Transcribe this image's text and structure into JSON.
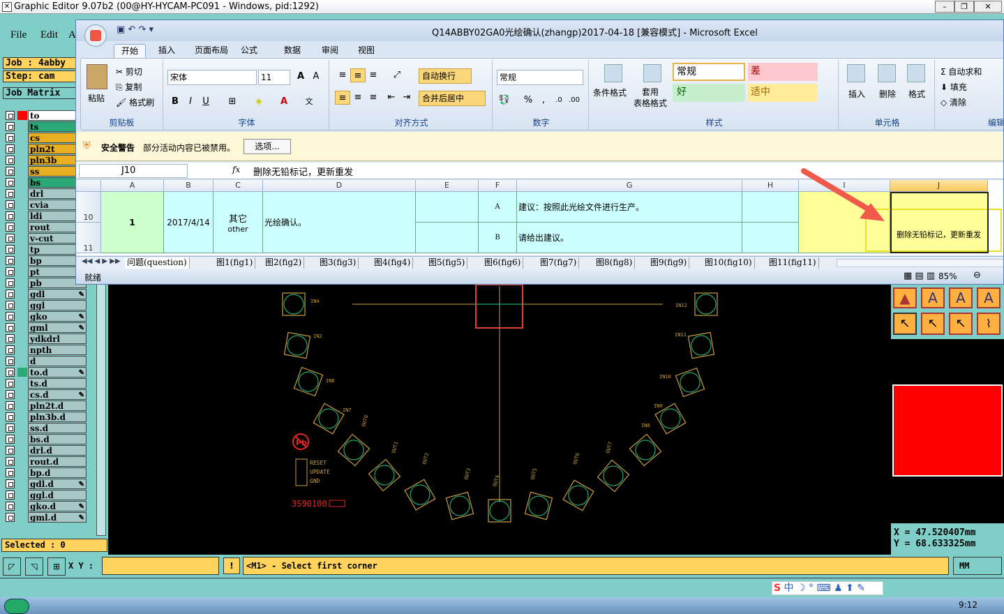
{
  "ge": {
    "title": "Graphic Editor 9.07b2 (00@HY-HYCAM-PC091 - Windows, pid:1292)",
    "menu": [
      "File",
      "Edit",
      "A"
    ],
    "job_label": "Job  : 4abby",
    "step_label": "Step: cam",
    "matrix_label": "Job Matrix",
    "layers": [
      {
        "name": "to",
        "color": "#ffffff",
        "sw": "#ff0000",
        "pen": false
      },
      {
        "name": "ts",
        "color": "#2aa876",
        "pen": false
      },
      {
        "name": "cs",
        "color": "#e8b020",
        "pen": false
      },
      {
        "name": "pln2t",
        "color": "#e8b020",
        "pen": false
      },
      {
        "name": "pln3b",
        "color": "#e8b020",
        "pen": false
      },
      {
        "name": "ss",
        "color": "#e8b020",
        "pen": false
      },
      {
        "name": "bs",
        "color": "#2aa876",
        "pen": false
      },
      {
        "name": "drl",
        "color": "#a8c8c8",
        "pen": false
      },
      {
        "name": "cvia",
        "color": "#a8c8c8",
        "pen": false
      },
      {
        "name": "ldi",
        "color": "#a8c8c8",
        "pen": false
      },
      {
        "name": "rout",
        "color": "#a8c8c8",
        "pen": false
      },
      {
        "name": "v-cut",
        "color": "#a8c8c8",
        "pen": false
      },
      {
        "name": "tp",
        "color": "#a8c8c8",
        "pen": false
      },
      {
        "name": "bp",
        "color": "#a8c8c8",
        "pen": false
      },
      {
        "name": "pt",
        "color": "#a8c8c8",
        "pen": false
      },
      {
        "name": "pb",
        "color": "#a8c8c8",
        "pen": false
      },
      {
        "name": "gdl",
        "color": "#a8c8c8",
        "pen": true
      },
      {
        "name": "ggl",
        "color": "#a8c8c8",
        "pen": false
      },
      {
        "name": "gko",
        "color": "#a8c8c8",
        "pen": true
      },
      {
        "name": "gml",
        "color": "#a8c8c8",
        "pen": true
      },
      {
        "name": "ydkdrl",
        "color": "#a8c8c8",
        "pen": false
      },
      {
        "name": "npth",
        "color": "#a8c8c8",
        "pen": false
      },
      {
        "name": "d",
        "color": "#a8c8c8",
        "pen": false
      },
      {
        "name": "to.d",
        "color": "#a8c8c8",
        "sw": "#2aa876",
        "pen": true
      },
      {
        "name": "ts.d",
        "color": "#a8c8c8",
        "pen": false
      },
      {
        "name": "cs.d",
        "color": "#a8c8c8",
        "pen": true
      },
      {
        "name": "pln2t.d",
        "color": "#a8c8c8",
        "pen": false
      },
      {
        "name": "pln3b.d",
        "color": "#a8c8c8",
        "pen": false
      },
      {
        "name": "ss.d",
        "color": "#a8c8c8",
        "pen": false
      },
      {
        "name": "bs.d",
        "color": "#a8c8c8",
        "pen": false
      },
      {
        "name": "drl.d",
        "color": "#a8c8c8",
        "pen": false
      },
      {
        "name": "rout.d",
        "color": "#a8c8c8",
        "pen": false
      },
      {
        "name": "bp.d",
        "color": "#a8c8c8",
        "pen": false
      },
      {
        "name": "gdl.d",
        "color": "#a8c8c8",
        "pen": true
      },
      {
        "name": "ggl.d",
        "color": "#a8c8c8",
        "pen": false
      },
      {
        "name": "gko.d",
        "color": "#a8c8c8",
        "pen": true
      },
      {
        "name": "gml.d",
        "color": "#a8c8c8",
        "pen": true
      }
    ],
    "selected": "Selected : 0",
    "coord_x": "X  =  47.520407mm",
    "coord_y": "Y  =  68.633325mm",
    "xy_label": "X Y :",
    "prompt": "<M1> - Select first corner",
    "units": "MM",
    "clock": "9:12",
    "pcb_labels": [
      "IN4",
      "IN2",
      "IN6",
      "IN7",
      "OUT0",
      "OUT1",
      "OUT2",
      "OUT3",
      "OUT4",
      "OUT5",
      "OUT6",
      "OUT7",
      "IN8",
      "IN10",
      "IN11",
      "IN12"
    ],
    "pcb_text": [
      "RESET",
      "UPDATE",
      "GND"
    ],
    "pcb_code": "3S90100"
  },
  "xl": {
    "title": "Q14ABBY02GA0光绘确认(zhangp)2017-04-18  [兼容模式] - Microsoft Excel",
    "tabs": [
      "开始",
      "插入",
      "页面布局",
      "公式",
      "数据",
      "审阅",
      "视图"
    ],
    "clipboard": {
      "paste": "粘贴",
      "cut": "剪切",
      "copy": "复制",
      "painter": "格式刷",
      "label": "剪贴板"
    },
    "font": {
      "name": "宋体",
      "size": "11",
      "label": "字体"
    },
    "align": {
      "wrap": "自动换行",
      "merge": "合并后居中",
      "label": "对齐方式"
    },
    "number": {
      "format": "常规",
      "label": "数字"
    },
    "styles": {
      "cond": "条件格式",
      "table": "套用\n表格格式",
      "normal": "常规",
      "bad": "差",
      "good": "好",
      "neutral": "适中",
      "label": "样式"
    },
    "cells": {
      "insert": "插入",
      "delete": "删除",
      "format": "格式",
      "label": "单元格"
    },
    "edit": {
      "autosum": "自动求和",
      "fill": "填充",
      "clear": "清除",
      "label": "编辑"
    },
    "security": {
      "warn": "安全警告",
      "msg": "部分活动内容已被禁用。",
      "opt": "选项..."
    },
    "namebox": "J10",
    "formula": "删除无铅标记，更新重发",
    "cols": [
      "A",
      "B",
      "C",
      "D",
      "E",
      "F",
      "G",
      "H",
      "I",
      "J"
    ],
    "rows": [
      "10",
      "11"
    ],
    "cells_data": {
      "A": "1",
      "B": "2017/4/14",
      "C1": "其它",
      "C2": "other",
      "D": "光绘确认。",
      "F1": "A",
      "F2": "B",
      "G1": "建议：按照此光绘文件进行生产。",
      "G2": "请给出建议。",
      "J": "删除无铅标记，更新重发"
    },
    "sheets": [
      "问题(question)",
      "图1(fig1)",
      "图2(fig2)",
      "图3(fig3)",
      "图4(fig4)",
      "图5(fig5)",
      "图6(fig6)",
      "图7(fig7)",
      "图8(fig8)",
      "图9(fig9)",
      "图10(fig10)",
      "图11(fig11)"
    ],
    "status": "就绪",
    "zoom": "85%"
  }
}
